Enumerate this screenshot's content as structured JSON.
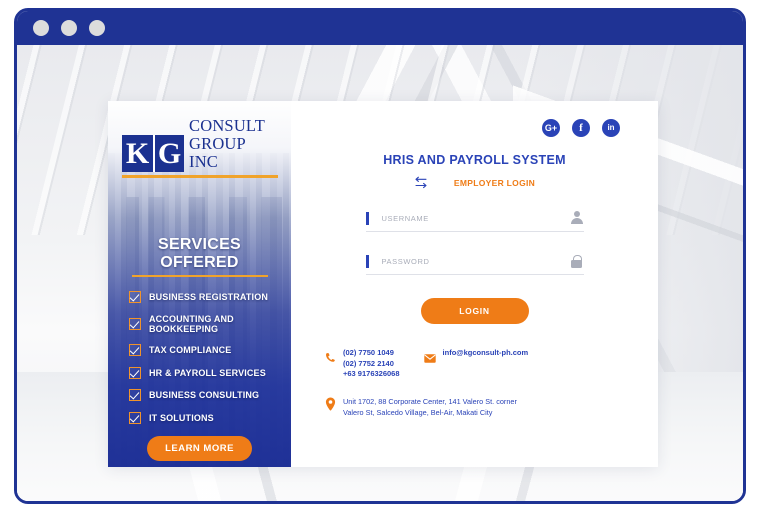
{
  "window": {
    "dots": [
      "close-dot",
      "minimize-dot",
      "maximize-dot"
    ]
  },
  "brand": {
    "logo_letter_1": "K",
    "logo_letter_2": "G",
    "logo_line_1": "CONSULT",
    "logo_line_2": "GROUP INC",
    "services_title": "SERVICES OFFERED",
    "services": [
      "BUSINESS REGISTRATION",
      "ACCOUNTING AND BOOKKEEPING",
      "TAX COMPLIANCE",
      "HR & PAYROLL SERVICES",
      "BUSINESS CONSULTING",
      "IT SOLUTIONS"
    ],
    "learn_more_label": "LEARN MORE"
  },
  "form": {
    "social": [
      {
        "name": "google-plus",
        "glyph": "G+"
      },
      {
        "name": "facebook",
        "glyph": "f"
      },
      {
        "name": "linkedin",
        "glyph": "in"
      }
    ],
    "system_title": "HRIS AND PAYROLL SYSTEM",
    "employer_login_label": "EMPLOYER LOGIN",
    "username": {
      "value": "",
      "placeholder": "USERNAME"
    },
    "password": {
      "value": "",
      "placeholder": "PASSWORD"
    },
    "login_label": "LOGIN"
  },
  "contact": {
    "phone_line_1": "(02) 7750 1049",
    "phone_line_2": "(02) 7752 2140",
    "phone_line_3": "+63 9176326068",
    "email": "info@kgconsult-ph.com",
    "address": "Unit 1702, 88 Corporate Center, 141 Valero St. corner Valero St, Salcedo Village, Bel-Air, Makati City"
  },
  "colors": {
    "brand_blue": "#1f3394",
    "accent_blue": "#2a43b7",
    "accent_orange": "#ef7c17",
    "gold": "#f0a32b",
    "title_bar": "#1f3394"
  }
}
